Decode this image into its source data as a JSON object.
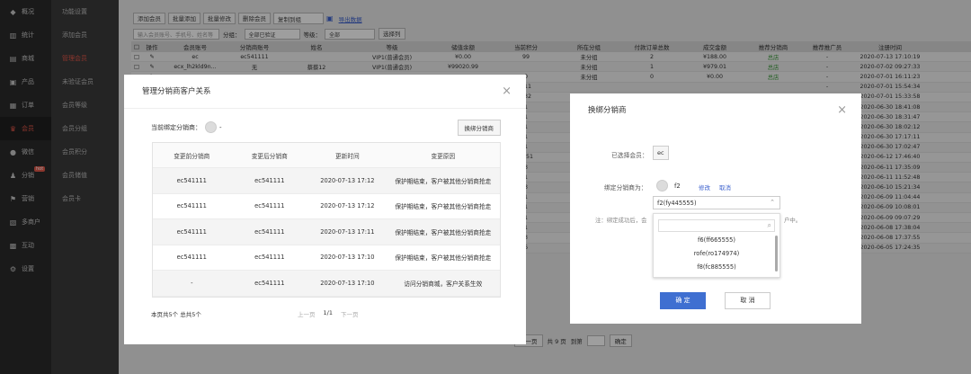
{
  "leftnav": {
    "items": [
      {
        "icon": "dashboard-icon",
        "glyph": "◆",
        "label": "概况"
      },
      {
        "icon": "stats-icon",
        "glyph": "▥",
        "label": "统计"
      },
      {
        "icon": "shop-icon",
        "glyph": "▤",
        "label": "商城"
      },
      {
        "icon": "product-icon",
        "glyph": "▣",
        "label": "产品"
      },
      {
        "icon": "order-icon",
        "glyph": "▦",
        "label": "订单"
      },
      {
        "icon": "member-icon",
        "glyph": "♛",
        "label": "会员"
      },
      {
        "icon": "wechat-icon",
        "glyph": "●",
        "label": "微信"
      },
      {
        "icon": "distribution-icon",
        "glyph": "♟",
        "label": "分销"
      },
      {
        "icon": "marketing-icon",
        "glyph": "⚑",
        "label": "营销"
      },
      {
        "icon": "multi-store-icon",
        "glyph": "▧",
        "label": "多商户"
      },
      {
        "icon": "interaction-icon",
        "glyph": "▩",
        "label": "互动"
      },
      {
        "icon": "settings-icon",
        "glyph": "⚙",
        "label": "设置"
      }
    ],
    "hot_badge": "hot"
  },
  "subnav": {
    "items": [
      "功能设置",
      "添加会员",
      "管理会员",
      "未验证会员",
      "会员等级",
      "会员分组",
      "会员积分",
      "会员储值",
      "会员卡"
    ]
  },
  "toolbar": {
    "add": "添加会员",
    "batch_add": "批量添加",
    "batch_edit": "批量修改",
    "delete": "删除会员",
    "copy_group": "复制到组",
    "export": "导出数据"
  },
  "filter": {
    "search_placeholder": "输入会员账号、手机号、姓名等",
    "group_label": "分组：",
    "group_value": "全部已验证",
    "level_label": "等级：",
    "level_value": "全部",
    "filter_btn": "选择列"
  },
  "table": {
    "headers": [
      "操作",
      "会员账号",
      "分销商账号",
      "姓名",
      "等级",
      "储值余额",
      "当前积分",
      "所在分组",
      "付款订单总数",
      "成交金额",
      "推荐分销商",
      "推荐推广员",
      "注册时间"
    ],
    "rows": [
      [
        "ec",
        "ec541111",
        "",
        "VIP1(普通会员)",
        "¥0.00",
        "99",
        "未分组",
        "2",
        "¥188.00",
        "总店",
        "-",
        "2020-07-13 17:10:19"
      ],
      [
        "ecx_lh2kld9n...",
        "无",
        "蔡蔡12",
        "VIP1(普通会员)",
        "¥99020.99",
        "",
        "未分组",
        "1",
        "¥979.01",
        "总店",
        "-",
        "2020-07-02 09:27:33"
      ],
      [
        "",
        "",
        "",
        "",
        "",
        "0",
        "未分组",
        "0",
        "¥0.00",
        "总店",
        "-",
        "2020-07-01 16:11:23"
      ],
      [
        "",
        "",
        "",
        "",
        "",
        "311",
        "",
        "",
        "",
        "",
        "-",
        "2020-07-01 15:54:34"
      ],
      [
        "",
        "",
        "",
        "",
        "",
        "232",
        "",
        "",
        "",
        "",
        "-",
        "2020-07-01 15:33:58"
      ],
      [
        "",
        "",
        "",
        "",
        "",
        "1",
        "",
        "",
        "",
        "",
        "-",
        "2020-06-30 18:41:08"
      ],
      [
        "",
        "",
        "",
        "",
        "",
        "1",
        "",
        "",
        "",
        "",
        "-",
        "2020-06-30 18:31:47"
      ],
      [
        "",
        "",
        "",
        "",
        "",
        "1",
        "",
        "",
        "",
        "",
        "-",
        "2020-06-30 18:02:12"
      ],
      [
        "",
        "",
        "",
        "",
        "",
        "1",
        "",
        "",
        "",
        "",
        "-",
        "2020-06-30 17:17:11"
      ],
      [
        "",
        "",
        "",
        "",
        "",
        "1",
        "",
        "",
        "",
        "",
        "-",
        "2020-06-30 17:02:47"
      ],
      [
        "",
        "",
        "",
        "",
        "",
        "1251",
        "",
        "",
        "",
        "",
        "-",
        "2020-06-12 17:46:40"
      ],
      [
        "",
        "",
        "",
        "",
        "",
        "3",
        "",
        "",
        "",
        "",
        "-",
        "2020-06-11 17:35:09"
      ],
      [
        "",
        "",
        "",
        "",
        "",
        "1",
        "",
        "",
        "",
        "",
        "-",
        "2020-06-11 11:52:48"
      ],
      [
        "",
        "",
        "",
        "",
        "",
        "3",
        "",
        "",
        "",
        "",
        "-",
        "2020-06-10 15:21:34"
      ],
      [
        "",
        "",
        "",
        "",
        "",
        "1",
        "",
        "",
        "",
        "",
        "-",
        "2020-06-09 11:04:44"
      ],
      [
        "",
        "",
        "",
        "",
        "",
        "1",
        "",
        "",
        "",
        "",
        "-",
        "2020-06-09 10:08:01"
      ],
      [
        "",
        "",
        "",
        "",
        "",
        "1",
        "",
        "",
        "",
        "",
        "-",
        "2020-06-09 09:07:29"
      ],
      [
        "",
        "",
        "",
        "",
        "",
        "1",
        "",
        "",
        "",
        "",
        "-",
        "2020-06-08 17:38:04"
      ],
      [
        "",
        "",
        "",
        "",
        "",
        "3",
        "",
        "",
        "",
        "",
        "-",
        "2020-06-08 17:37:55"
      ],
      [
        "",
        "",
        "",
        "",
        "",
        "6",
        "",
        "",
        "",
        "",
        "-",
        "2020-06-05 17:24:35"
      ]
    ]
  },
  "pager": {
    "next": "下一页",
    "total": "共 9 页",
    "goto": "到第",
    "confirm": "确定"
  },
  "dialog1": {
    "title": "管理分销商客户关系",
    "current_label": "当前绑定分销商：",
    "current_value": "-",
    "rebind_btn": "换绑分销商",
    "headers": [
      "变更前分销商",
      "变更后分销商",
      "更新时间",
      "变更原因"
    ],
    "rows": [
      [
        "ec541111",
        "ec541111",
        "2020-07-13 17:12",
        "保护期结束，客户被其他分销商抢走"
      ],
      [
        "ec541111",
        "ec541111",
        "2020-07-13 17:12",
        "保护期结束，客户被其他分销商抢走"
      ],
      [
        "ec541111",
        "ec541111",
        "2020-07-13 17:11",
        "保护期结束，客户被其他分销商抢走"
      ],
      [
        "ec541111",
        "ec541111",
        "2020-07-13 17:10",
        "保护期结束，客户被其他分销商抢走"
      ],
      [
        "-",
        "ec541111",
        "2020-07-13 17:10",
        "访问分销商城，客户关系生效"
      ]
    ],
    "summary": "本页共5个  总共5个",
    "prev": "上一页",
    "page": "1/1",
    "next": "下一页"
  },
  "dialog2": {
    "title": "换绑分销商",
    "selected_label": "已选择会员：",
    "selected_value": "ec",
    "bind_label": "绑定分销商为：",
    "bind_value": "f2",
    "edit_link": "修改",
    "cancel_link": "取消",
    "select_value": "f2(fy445555)",
    "options": [
      "f6(ff665555)",
      "rofe(ro174974)",
      "f8(fc885555)"
    ],
    "note": "注：绑定成功后，会",
    "note_tail": "户中。",
    "ok": "确 定",
    "cancel": "取 消"
  }
}
